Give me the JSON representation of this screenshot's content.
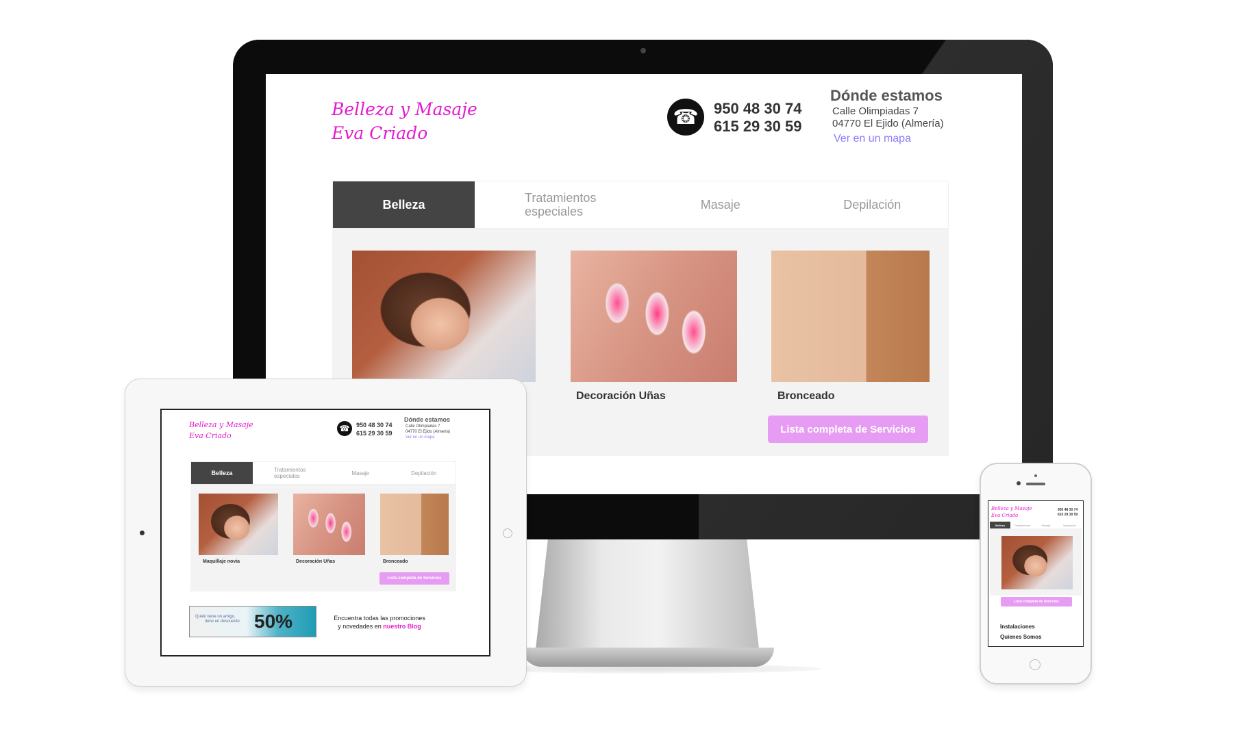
{
  "site": {
    "logo_line1": "Belleza y Masaje",
    "logo_line2": "Eva Criado",
    "phone_1": "950 48 30 74",
    "phone_2": "615 29 30 59",
    "location_heading": "Dónde estamos",
    "address_1": "Calle Olimpiadas 7",
    "address_2": "04770 El Ejido (Almería)",
    "map_link": "Ver en un mapa",
    "tabs": [
      {
        "label": "Belleza"
      },
      {
        "label": "Tratamientos especiales"
      },
      {
        "label": "Masaje"
      },
      {
        "label": "Depilación"
      }
    ],
    "mobile_tab_2": "Tratamientos",
    "services": [
      {
        "caption": "Maquillaje novia"
      },
      {
        "caption": "Decoración Uñas"
      },
      {
        "caption": "Bronceado"
      }
    ],
    "services_button": "Lista completa de Servicios",
    "promo_text_1": "Encuentra todas las promociones",
    "promo_text_2": "y novedades en",
    "promo_link": "nuestro Blog",
    "promo_banner_line1": "Quién tiene un amigo,",
    "promo_banner_line2": "tiene un descuento",
    "promo_banner_value": "50%",
    "mobile_menu": [
      "Instalaciones",
      "Quienes Somos"
    ]
  },
  "icons": {
    "phone": "phone-icon"
  },
  "colors": {
    "brand_pink": "#e41bd0",
    "button_pink": "#e69cf3",
    "link_purple": "#8a7cff",
    "active_tab": "#444444"
  }
}
